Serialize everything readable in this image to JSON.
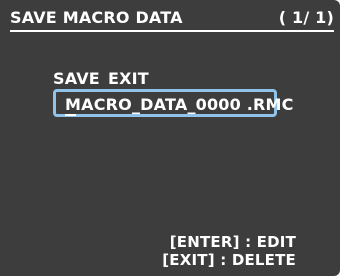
{
  "header": {
    "title": "SAVE MACRO DATA",
    "page_indicator": "( 1/ 1)"
  },
  "menu": {
    "items": [
      {
        "label": "SAVE"
      },
      {
        "label": "EXIT"
      }
    ]
  },
  "file": {
    "name": "MACRO_DATA_0000 .RMC"
  },
  "help": {
    "line1": "[ENTER] : EDIT",
    "line2": "[EXIT] : DELETE"
  },
  "colors": {
    "screen_bg": "#3d3d3d",
    "text": "#ffffff",
    "highlight_border": "#8fc3ea"
  }
}
